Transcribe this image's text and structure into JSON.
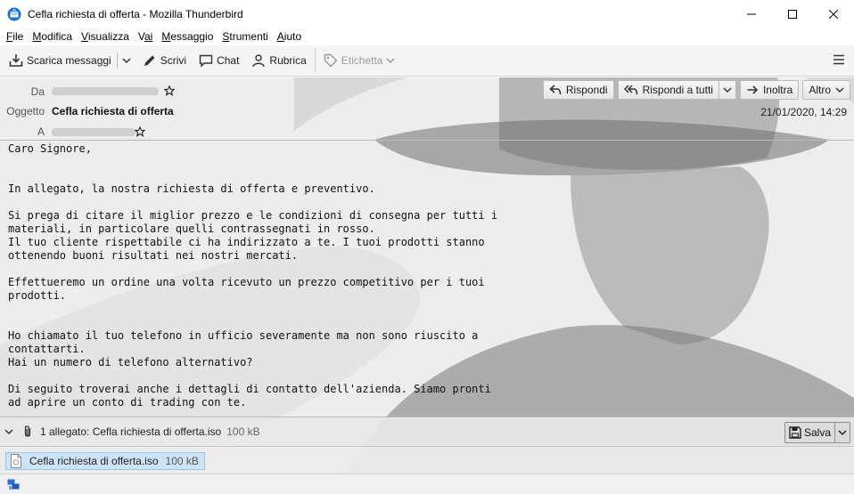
{
  "window": {
    "title": "Cefla richiesta di offerta - Mozilla Thunderbird"
  },
  "menubar": [
    {
      "accel": "F",
      "rest": "ile"
    },
    {
      "accel": "M",
      "rest": "odifica"
    },
    {
      "accel": "V",
      "rest": "isualizza"
    },
    {
      "accel": "V",
      "rest": "ai"
    },
    {
      "accel": "M",
      "rest": "essaggio"
    },
    {
      "accel": "S",
      "rest": "trumenti"
    },
    {
      "accel": "A",
      "rest": "iuto"
    }
  ],
  "toolbar": {
    "get_messages": "Scarica messaggi",
    "write": "Scrivi",
    "chat": "Chat",
    "address_book": "Rubrica",
    "tag": "Etichetta"
  },
  "header": {
    "from_label": "Da",
    "subject_label": "Oggetto",
    "to_label": "A",
    "subject": "Cefla richiesta di offerta",
    "date": "21/01/2020, 14:29",
    "reply": "Rispondi",
    "reply_all": "Rispondi a tutti",
    "forward": "Inoltra",
    "more": "Altro"
  },
  "body": {
    "lines": [
      "Caro Signore,",
      "",
      "",
      "In allegato, la nostra richiesta di offerta e preventivo.",
      "",
      "Si prega di citare il miglior prezzo e le condizioni di consegna per tutti i",
      "materiali, in particolare quelli contrassegnati in rosso.",
      "Il tuo cliente rispettabile ci ha indirizzato a te. I tuoi prodotti stanno",
      "ottenendo buoni risultati nei nostri mercati.",
      "",
      "Effettueremo un ordine una volta ricevuto un prezzo competitivo per i tuoi",
      "prodotti.",
      "",
      "",
      "Ho chiamato il tuo telefono in ufficio severamente ma non sono riuscito a",
      "contattarti.",
      "Hai un numero di telefono alternativo?",
      "",
      "Di seguito troverai anche i dettagli di contatto dell'azienda. Siamo pronti",
      "ad aprire un conto di trading con te."
    ]
  },
  "attachments": {
    "summary": "1 allegato: Cefla richiesta di offerta.iso",
    "summary_size": "100 kB",
    "save": "Salva",
    "items": [
      {
        "name": "Cefla richiesta di offerta.iso",
        "size": "100 kB"
      }
    ]
  },
  "icons": {
    "app": "thunderbird-icon",
    "minimize": "minimize-icon",
    "maximize": "maximize-icon",
    "close": "close-icon",
    "get_messages": "download-tray-icon",
    "write": "pencil-icon",
    "chat": "chat-bubble-icon",
    "address_book": "contacts-icon",
    "tag": "tag-icon",
    "menu": "hamburger-icon",
    "reply": "reply-icon",
    "reply_all": "reply-all-icon",
    "forward": "forward-icon",
    "star": "star-icon",
    "paperclip": "paperclip-icon",
    "save": "floppy-disk-icon",
    "file": "file-icon",
    "status": "network-status-icon"
  },
  "colors": {
    "selection": "#cde3f7",
    "selection_border": "#9cc6ea",
    "accent": "#1565c0"
  }
}
